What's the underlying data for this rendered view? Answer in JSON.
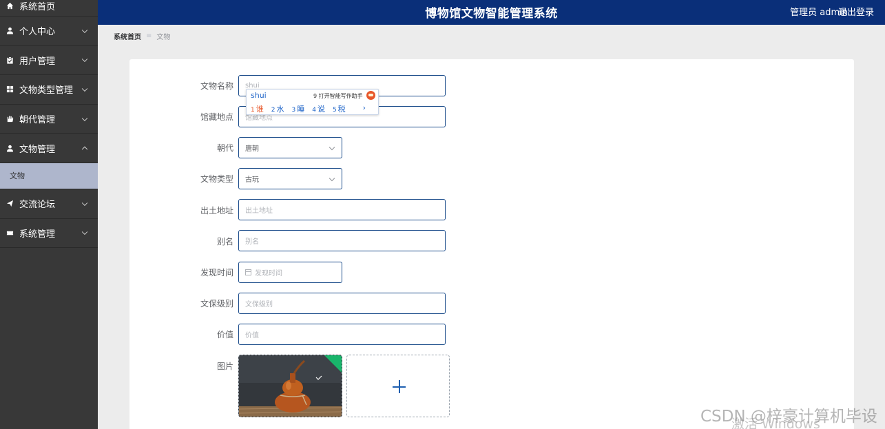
{
  "header": {
    "title": "博物馆文物智能管理系统",
    "user": "管理员 admin",
    "logout": "退出登录"
  },
  "sidebar": {
    "items": [
      {
        "label": "系统首页",
        "icon": "home-icon",
        "expandable": false
      },
      {
        "label": "个人中心",
        "icon": "user-icon",
        "expandable": true
      },
      {
        "label": "用户管理",
        "icon": "clipboard-icon",
        "expandable": true
      },
      {
        "label": "文物类型管理",
        "icon": "grid-icon",
        "expandable": true
      },
      {
        "label": "朝代管理",
        "icon": "hand-icon",
        "expandable": true
      },
      {
        "label": "文物管理",
        "icon": "user-icon",
        "expandable": true,
        "expanded": true
      },
      {
        "label": "交流论坛",
        "icon": "send-icon",
        "expandable": true
      },
      {
        "label": "系统管理",
        "icon": "ticket-icon",
        "expandable": true
      }
    ],
    "submenu": {
      "label": "文物"
    }
  },
  "breadcrumb": {
    "home": "系统首页",
    "separator": "≡",
    "current": "文物"
  },
  "form": {
    "name": {
      "label": "文物名称",
      "value": "shui"
    },
    "location": {
      "label": "馆藏地点",
      "placeholder": "馆藏地点"
    },
    "dynasty": {
      "label": "朝代",
      "value": "唐朝"
    },
    "type": {
      "label": "文物类型",
      "value": "古玩"
    },
    "origin": {
      "label": "出土地址",
      "placeholder": "出土地址"
    },
    "alias": {
      "label": "别名",
      "placeholder": "别名"
    },
    "discovery": {
      "label": "发现时间",
      "placeholder": "发现时间"
    },
    "protection": {
      "label": "文保级别",
      "placeholder": "文保级别"
    },
    "price": {
      "label": "价值",
      "placeholder": "价值"
    },
    "image": {
      "label": "图片"
    }
  },
  "ime": {
    "pinyin": "shui",
    "assistant": "9 打开智能写作助手",
    "candidates": [
      {
        "num": "1",
        "text": "谁"
      },
      {
        "num": "2",
        "text": "水"
      },
      {
        "num": "3",
        "text": "睡"
      },
      {
        "num": "4",
        "text": "说"
      },
      {
        "num": "5",
        "text": "税"
      }
    ],
    "more": "›"
  },
  "watermark": {
    "csdn": "CSDN @梓豪计算机毕设",
    "windows": "激活 Windows"
  },
  "colors": {
    "header": "#0a2f79",
    "sidebar": "#383838",
    "submenu": "#aeb6cc",
    "accent": "#1e5fb0"
  }
}
